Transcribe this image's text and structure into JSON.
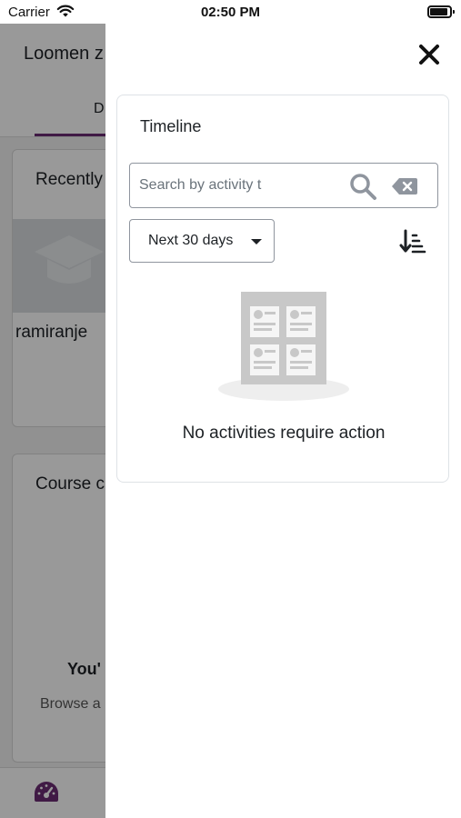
{
  "status_bar": {
    "carrier": "Carrier",
    "time": "02:50 PM"
  },
  "background": {
    "site_title": "Loomen z",
    "tab_label": "D",
    "recent_card_title": "Recently",
    "recent_course_name": "ramiranje",
    "course_card_title": "Course c",
    "empty_title": "You'",
    "empty_text": "Browse a"
  },
  "timeline": {
    "title": "Timeline",
    "search": {
      "placeholder": "Search by activity t",
      "value": ""
    },
    "filter": {
      "selected": "Next 30 days"
    },
    "empty_message": "No activities require action"
  },
  "icons": {
    "close": "close-icon",
    "search": "search-icon",
    "clear": "clear-icon",
    "sort": "sort-icon",
    "wifi": "wifi-icon",
    "dashboard": "dashboard-icon"
  },
  "colors": {
    "accent": "#6b2c73",
    "text": "#1d2125",
    "border": "#8f959e"
  }
}
